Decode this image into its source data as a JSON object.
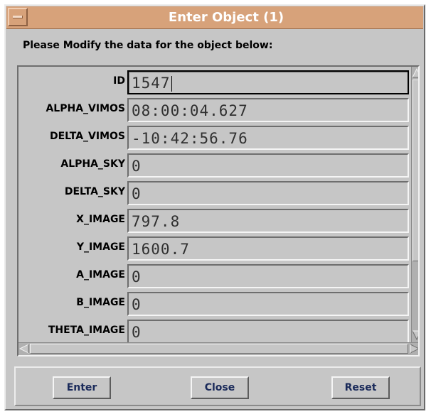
{
  "window": {
    "title": "Enter Object (1)"
  },
  "prompt": "Please Modify the data for the object below:",
  "fields": [
    {
      "label": "ID",
      "value": "1547"
    },
    {
      "label": "ALPHA_VIMOS",
      "value": "08:00:04.627"
    },
    {
      "label": "DELTA_VIMOS",
      "value": "-10:42:56.76"
    },
    {
      "label": "ALPHA_SKY",
      "value": "0"
    },
    {
      "label": "DELTA_SKY",
      "value": "0"
    },
    {
      "label": "X_IMAGE",
      "value": "797.8"
    },
    {
      "label": "Y_IMAGE",
      "value": "1600.7"
    },
    {
      "label": "A_IMAGE",
      "value": "0"
    },
    {
      "label": "B_IMAGE",
      "value": "0"
    },
    {
      "label": "THETA_IMAGE",
      "value": "0"
    }
  ],
  "buttons": {
    "enter": "Enter",
    "close": "Close",
    "reset": "Reset"
  },
  "colors": {
    "titlebar": "#d7a27a",
    "background": "#c6c6c6",
    "button_text": "#1a2a5a"
  }
}
